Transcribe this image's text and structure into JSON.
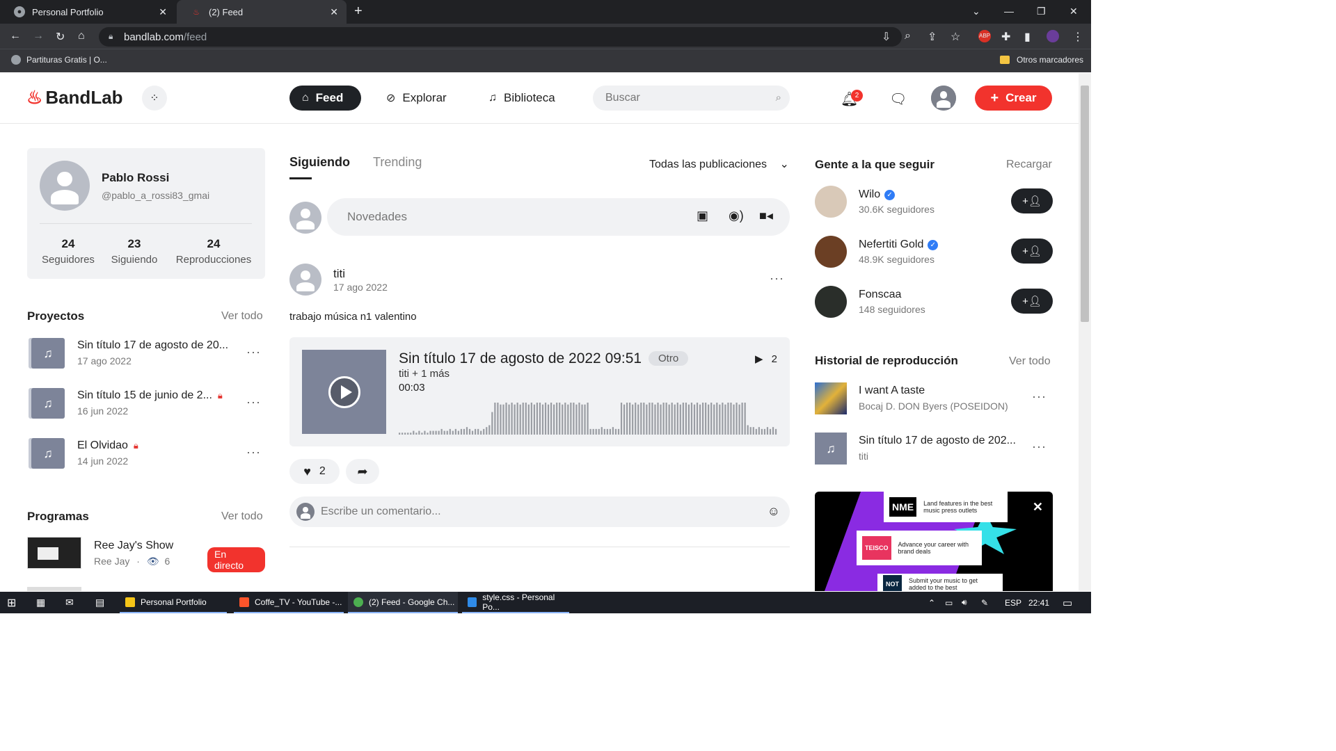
{
  "browser": {
    "tabs": [
      {
        "title": "Personal Portfolio",
        "active": false
      },
      {
        "title": "(2) Feed",
        "active": true
      }
    ],
    "url_host": "bandlab.com",
    "url_path": "/feed",
    "bookmarks": [
      {
        "label": "Partituras Gratis | O..."
      }
    ],
    "other_bookmarks": "Otros marcadores"
  },
  "header": {
    "logo": "BandLab",
    "nav": [
      {
        "label": "Feed",
        "icon": "home-icon",
        "active": true
      },
      {
        "label": "Explorar",
        "icon": "compass-icon",
        "active": false
      },
      {
        "label": "Biblioteca",
        "icon": "library-icon",
        "active": false
      }
    ],
    "search_placeholder": "Buscar",
    "notification_count": "2",
    "create_label": "Crear"
  },
  "profile": {
    "name": "Pablo Rossi",
    "handle": "@pablo_a_rossi83_gmai",
    "stats": [
      {
        "value": "24",
        "label": "Seguidores"
      },
      {
        "value": "23",
        "label": "Siguiendo"
      },
      {
        "value": "24",
        "label": "Reproducciones"
      }
    ]
  },
  "projects": {
    "title": "Proyectos",
    "see_all": "Ver todo",
    "items": [
      {
        "title": "Sin título 17 de agosto de 20...",
        "date": "17 ago 2022",
        "locked": false
      },
      {
        "title": "Sin título 15 de junio de 2...",
        "date": "16 jun 2022",
        "locked": true
      },
      {
        "title": "El Olvidao",
        "date": "14 jun 2022",
        "locked": true
      }
    ]
  },
  "programs": {
    "title": "Programas",
    "see_all": "Ver todo",
    "items": [
      {
        "title": "Ree Jay's Show",
        "host": "Ree Jay",
        "viewers": "6",
        "badge": "En directo"
      }
    ]
  },
  "feed": {
    "tabs": [
      "Siguiendo",
      "Trending"
    ],
    "filter": "Todas las publicaciones",
    "composer_placeholder": "Novedades",
    "post": {
      "author": "titi",
      "date": "17 ago 2022",
      "text": "trabajo música n1 valentino",
      "track": {
        "title": "Sin título 17 de agosto de 2022 09:51",
        "tag": "Otro",
        "plays": "2",
        "artists": "titi + 1 más",
        "duration": "00:03",
        "waveform": [
          1,
          1,
          1,
          1,
          1,
          2,
          1,
          2,
          1,
          2,
          1,
          2,
          2,
          2,
          2,
          3,
          2,
          2,
          3,
          2,
          3,
          2,
          3,
          3,
          4,
          3,
          2,
          3,
          3,
          2,
          3,
          4,
          5,
          12,
          17,
          17,
          16,
          16,
          17,
          16,
          17,
          16,
          17,
          16,
          17,
          17,
          16,
          17,
          16,
          17,
          17,
          16,
          17,
          16,
          17,
          16,
          17,
          17,
          16,
          17,
          16,
          17,
          17,
          16,
          17,
          16,
          16,
          17,
          3,
          3,
          3,
          3,
          4,
          3,
          3,
          3,
          4,
          3,
          3,
          17,
          16,
          17,
          17,
          16,
          17,
          16,
          17,
          17,
          16,
          17,
          17,
          16,
          17,
          16,
          17,
          17,
          16,
          17,
          16,
          17,
          16,
          17,
          17,
          16,
          17,
          16,
          17,
          16,
          17,
          17,
          16,
          17,
          16,
          17,
          16,
          17,
          16,
          17,
          17,
          16,
          17,
          16,
          17,
          17,
          5,
          4,
          4,
          3,
          4,
          3,
          3,
          4,
          3,
          4,
          3
        ]
      },
      "likes": "2",
      "comment_placeholder": "Escribe un comentario..."
    }
  },
  "suggestions": {
    "title": "Gente a la que seguir",
    "reload": "Recargar",
    "people": [
      {
        "name": "Wilo",
        "verified": true,
        "followers": "30.6K seguidores",
        "color": "#d9c9b8"
      },
      {
        "name": "Nefertiti Gold",
        "verified": true,
        "followers": "48.9K seguidores",
        "color": "#6b3f24"
      },
      {
        "name": "Fonscaa",
        "verified": false,
        "followers": "148 seguidores",
        "color": "#2a2e2a"
      }
    ]
  },
  "history": {
    "title": "Historial de reproducción",
    "see_all": "Ver todo",
    "items": [
      {
        "title": "I want A taste",
        "artist": "Bocaj D. DON Byers (POSEIDON)"
      },
      {
        "title": "Sin título 17 de agosto de 202...",
        "artist": "titi"
      }
    ]
  },
  "ad": {
    "cards": [
      {
        "brand": "NME",
        "text": "Land features in the best music press outlets"
      },
      {
        "brand": "TEISCO",
        "text": "Advance your career with brand deals"
      },
      {
        "brand": "NOT",
        "text": "Submit your music to get added to the best"
      }
    ]
  },
  "taskbar": {
    "apps": [
      {
        "label": "Personal Portfolio",
        "color": "#f5c518"
      },
      {
        "label": "Coffe_TV - YouTube -...",
        "color": "#fb542b"
      },
      {
        "label": "(2) Feed - Google Ch...",
        "color": "#4caf50"
      },
      {
        "label": "style.css - Personal Po...",
        "color": "#2f8be8"
      }
    ],
    "lang": "ESP",
    "time": "22:41"
  }
}
